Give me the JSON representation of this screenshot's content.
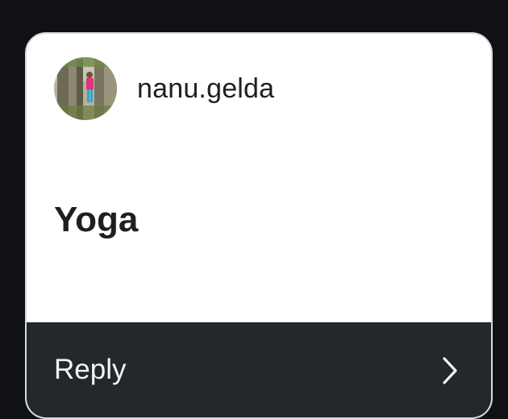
{
  "post": {
    "username": "nanu.gelda",
    "avatar_icon": "profile-photo-tree",
    "message": "Yoga"
  },
  "reply": {
    "label": "Reply",
    "icon": "chevron-right-icon"
  },
  "colors": {
    "background": "#0f1115",
    "card": "#ffffff",
    "reply_bar": "#24272c",
    "text_dark": "#1d1f23",
    "text_light": "#f2f3f5"
  }
}
